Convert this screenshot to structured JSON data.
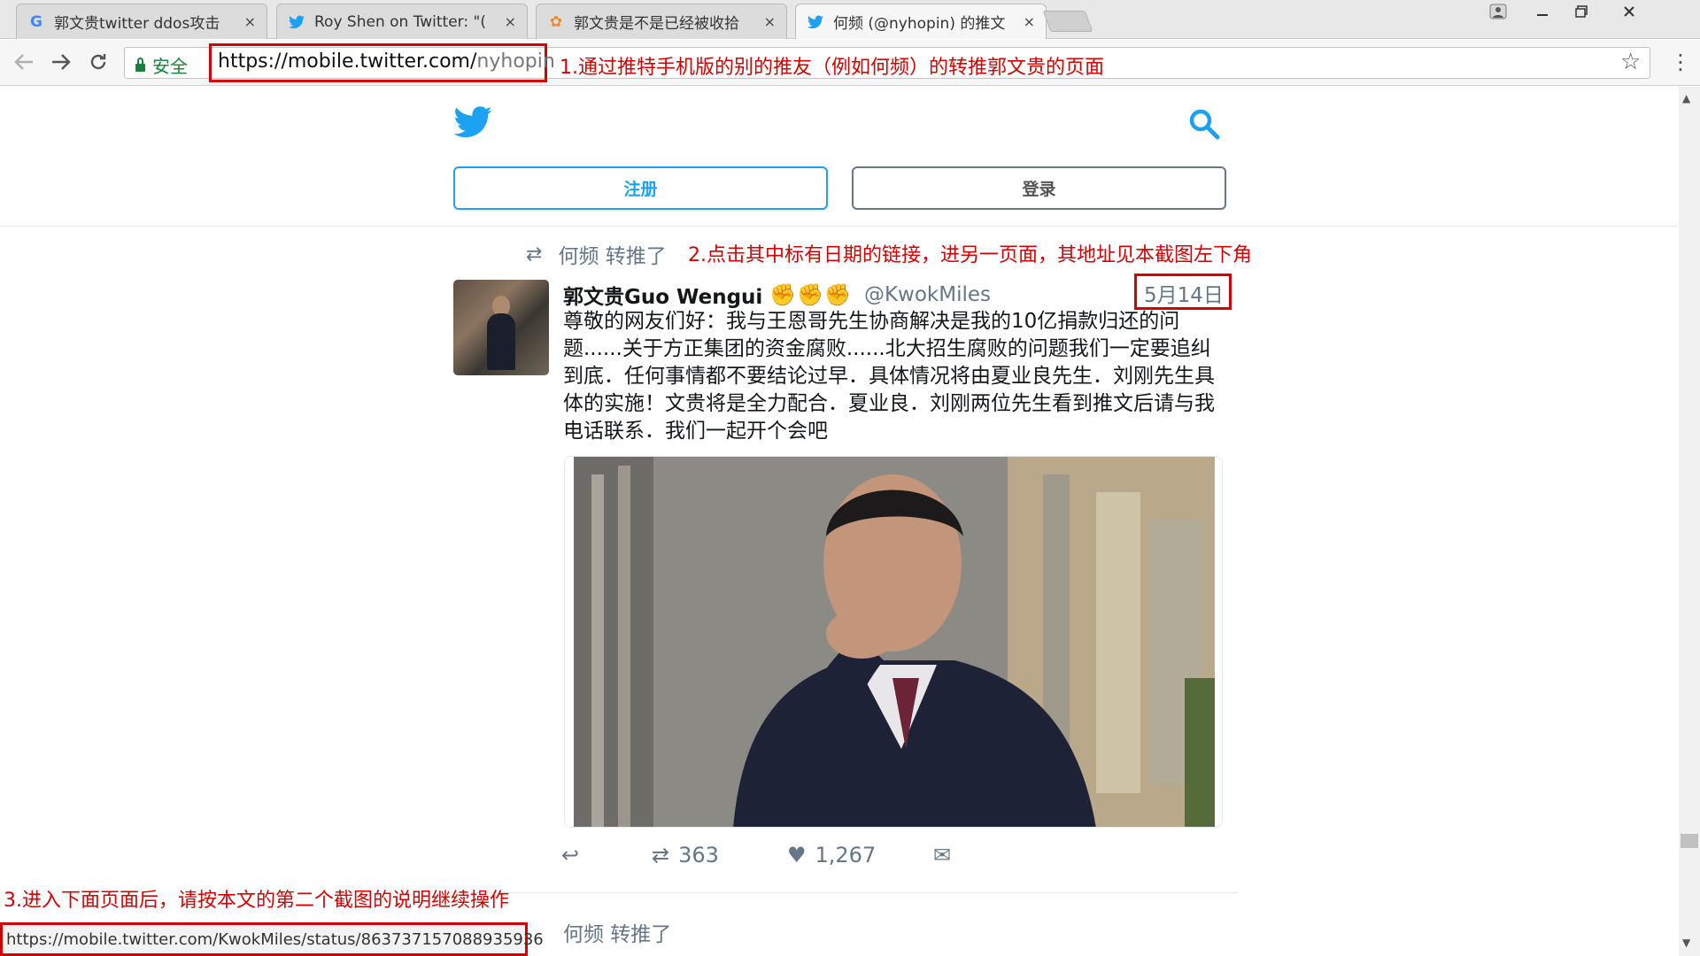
{
  "browser": {
    "tabs": [
      {
        "favicon": "google-g-icon",
        "title": "郭文贵twitter ddos攻击",
        "close": "×"
      },
      {
        "favicon": "twitter-bird-icon",
        "title": "Roy Shen on Twitter: \"(",
        "close": "×"
      },
      {
        "favicon": "flower-icon",
        "title": "郭文贵是不是已经被收拾",
        "close": "×"
      },
      {
        "favicon": "twitter-bird-icon",
        "title": "何频 (@nyhopin) 的推文",
        "close": "×"
      }
    ],
    "secure_label": "安全",
    "url_scheme_host": "https://mobile.twitter.com/",
    "url_path": "nyhopin"
  },
  "annotations": {
    "step1": "1.通过推特手机版的别的推友（例如何频）的转推郭文贵的页面",
    "step2": "2.点击其中标有日期的链接，进另一页面，其地址见本截图左下角",
    "step3": "3.进入下面页面后，请按本文的第二个截图的说明继续操作"
  },
  "page": {
    "signup_label": "注册",
    "login_label": "登录",
    "retweet_line": "何频 转推了",
    "tweet": {
      "name": "郭文贵Guo Wengui",
      "emoji": "✊✊✊",
      "handle": "@KwokMiles",
      "date": "5月14日",
      "text": "尊敬的网友们好：我与王恩哥先生协商解决是我的10亿捐款归还的问题......关于方正集团的资金腐败......北大招生腐败的问题我们一定要追纠到底．任何事情都不要结论过早．具体情况将由夏业良先生．刘刚先生具体的实施！文贵将是全力配合．夏业良．刘刚两位先生看到推文后请与我电话联系．我们一起开个会吧",
      "retweet_count": "363",
      "like_count": "1,267"
    },
    "next_retweet_line": "何频 转推了"
  },
  "status_bar": {
    "url": "https://mobile.twitter.com/KwokMiles/status/863737157088935936"
  },
  "colors": {
    "annotation_red": "#d40000",
    "twitter_blue": "#1da1f2",
    "secure_green": "#188038"
  }
}
